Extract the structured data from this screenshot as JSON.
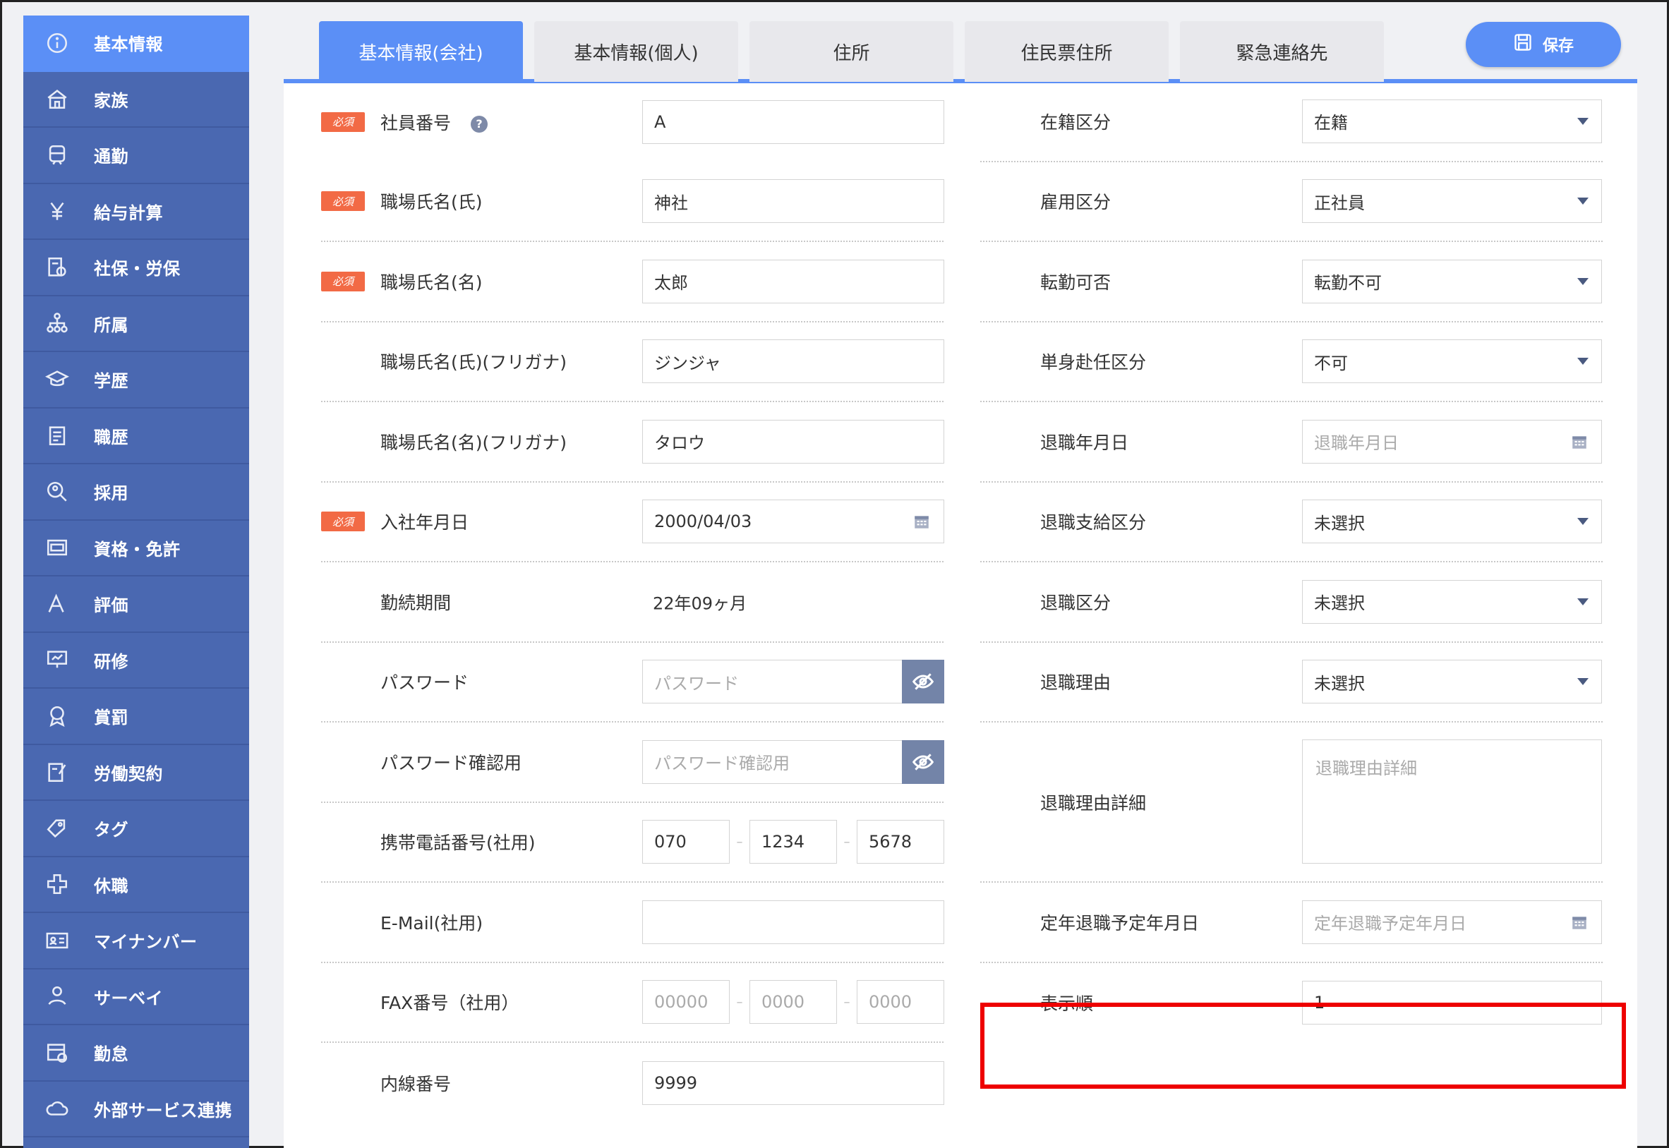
{
  "sidebar": {
    "items": [
      {
        "label": "基本情報",
        "icon": "info-icon",
        "active": true
      },
      {
        "label": "家族",
        "icon": "house-icon"
      },
      {
        "label": "通勤",
        "icon": "train-icon"
      },
      {
        "label": "給与計算",
        "icon": "yen-icon"
      },
      {
        "label": "社保・労保",
        "icon": "insurance-icon"
      },
      {
        "label": "所属",
        "icon": "org-chart-icon"
      },
      {
        "label": "学歴",
        "icon": "graduation-cap-icon"
      },
      {
        "label": "職歴",
        "icon": "career-icon"
      },
      {
        "label": "採用",
        "icon": "recruit-search-icon"
      },
      {
        "label": "資格・免許",
        "icon": "license-icon"
      },
      {
        "label": "評価",
        "icon": "evaluation-icon"
      },
      {
        "label": "研修",
        "icon": "training-board-icon"
      },
      {
        "label": "賞罰",
        "icon": "award-icon"
      },
      {
        "label": "労働契約",
        "icon": "contract-icon"
      },
      {
        "label": "タグ",
        "icon": "tag-icon"
      },
      {
        "label": "休職",
        "icon": "cross-icon"
      },
      {
        "label": "マイナンバー",
        "icon": "id-card-icon"
      },
      {
        "label": "サーベイ",
        "icon": "survey-icon"
      },
      {
        "label": "勤怠",
        "icon": "calendar-clock-icon"
      },
      {
        "label": "外部サービス連携",
        "icon": "cloud-icon"
      }
    ]
  },
  "tabs": [
    {
      "label": "基本情報(会社)",
      "active": true
    },
    {
      "label": "基本情報(個人)"
    },
    {
      "label": "住所"
    },
    {
      "label": "住民票住所"
    },
    {
      "label": "緊急連絡先"
    }
  ],
  "save_label": "保存",
  "required_label": "必須",
  "left": {
    "employee_no": {
      "label": "社員番号",
      "value": "A"
    },
    "last_name": {
      "label": "職場氏名(氏)",
      "value": "神社"
    },
    "first_name": {
      "label": "職場氏名(名)",
      "value": "太郎"
    },
    "last_kana": {
      "label": "職場氏名(氏)(フリガナ)",
      "value": "ジンジャ"
    },
    "first_kana": {
      "label": "職場氏名(名)(フリガナ)",
      "value": "タロウ"
    },
    "join_date": {
      "label": "入社年月日",
      "value": "2000/04/03"
    },
    "tenure": {
      "label": "勤続期間",
      "value": "22年09ヶ月"
    },
    "password": {
      "label": "パスワード",
      "placeholder": "パスワード"
    },
    "password_confirm": {
      "label": "パスワード確認用",
      "placeholder": "パスワード確認用"
    },
    "mobile": {
      "label": "携帯電話番号(社用)",
      "parts": [
        "070",
        "1234",
        "5678"
      ]
    },
    "email": {
      "label": "E-Mail(社用)",
      "value": ""
    },
    "fax": {
      "label": "FAX番号（社用）",
      "placeholders": [
        "00000",
        "0000",
        "0000"
      ]
    },
    "extension": {
      "label": "内線番号",
      "value": "9999"
    }
  },
  "right": {
    "enrollment": {
      "label": "在籍区分",
      "value": "在籍"
    },
    "employment": {
      "label": "雇用区分",
      "value": "正社員"
    },
    "transfer": {
      "label": "転勤可否",
      "value": "転勤不可"
    },
    "solo_posting": {
      "label": "単身赴任区分",
      "value": "不可"
    },
    "retire_date": {
      "label": "退職年月日",
      "placeholder": "退職年月日"
    },
    "retire_pay": {
      "label": "退職支給区分",
      "value": "未選択"
    },
    "retire_type": {
      "label": "退職区分",
      "value": "未選択"
    },
    "retire_reason": {
      "label": "退職理由",
      "value": "未選択"
    },
    "retire_detail": {
      "label": "退職理由詳細",
      "placeholder": "退職理由詳細"
    },
    "mandatory_retire": {
      "label": "定年退職予定年月日",
      "placeholder": "定年退職予定年月日"
    },
    "display_order": {
      "label": "表示順",
      "value": "1"
    }
  },
  "colors": {
    "accent": "#5b8ff6",
    "sidebar": "#4a68b1",
    "required": "#f26a45",
    "highlight": "#e00000"
  }
}
